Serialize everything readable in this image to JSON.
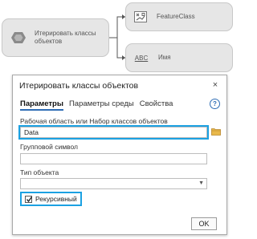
{
  "diagram": {
    "tool_node": {
      "label": "Итерировать классы объектов"
    },
    "output_featureclass": {
      "label": "FeatureClass"
    },
    "output_name": {
      "label": "Имя",
      "icon_text": "ABC"
    }
  },
  "dialog": {
    "title": "Итерировать классы объектов",
    "close_label": "×",
    "tabs": [
      {
        "label": "Параметры",
        "active": true
      },
      {
        "label": "Параметры среды",
        "active": false
      },
      {
        "label": "Свойства",
        "active": false
      }
    ],
    "help_label": "?",
    "fields": {
      "workspace": {
        "label": "Рабочая область или Набор классов объектов",
        "value": "Data"
      },
      "wildcard": {
        "label": "Групповой символ",
        "value": ""
      },
      "feature_type": {
        "label": "Тип объекта",
        "value": ""
      }
    },
    "recursive": {
      "label": "Рекурсивный",
      "checked": true
    },
    "ok_label": "OK"
  },
  "colors": {
    "highlight": "#1ba1e2",
    "node_fill": "#e6e6e6",
    "tab_underline": "#2f6db5",
    "folder": "#e8b84a"
  }
}
